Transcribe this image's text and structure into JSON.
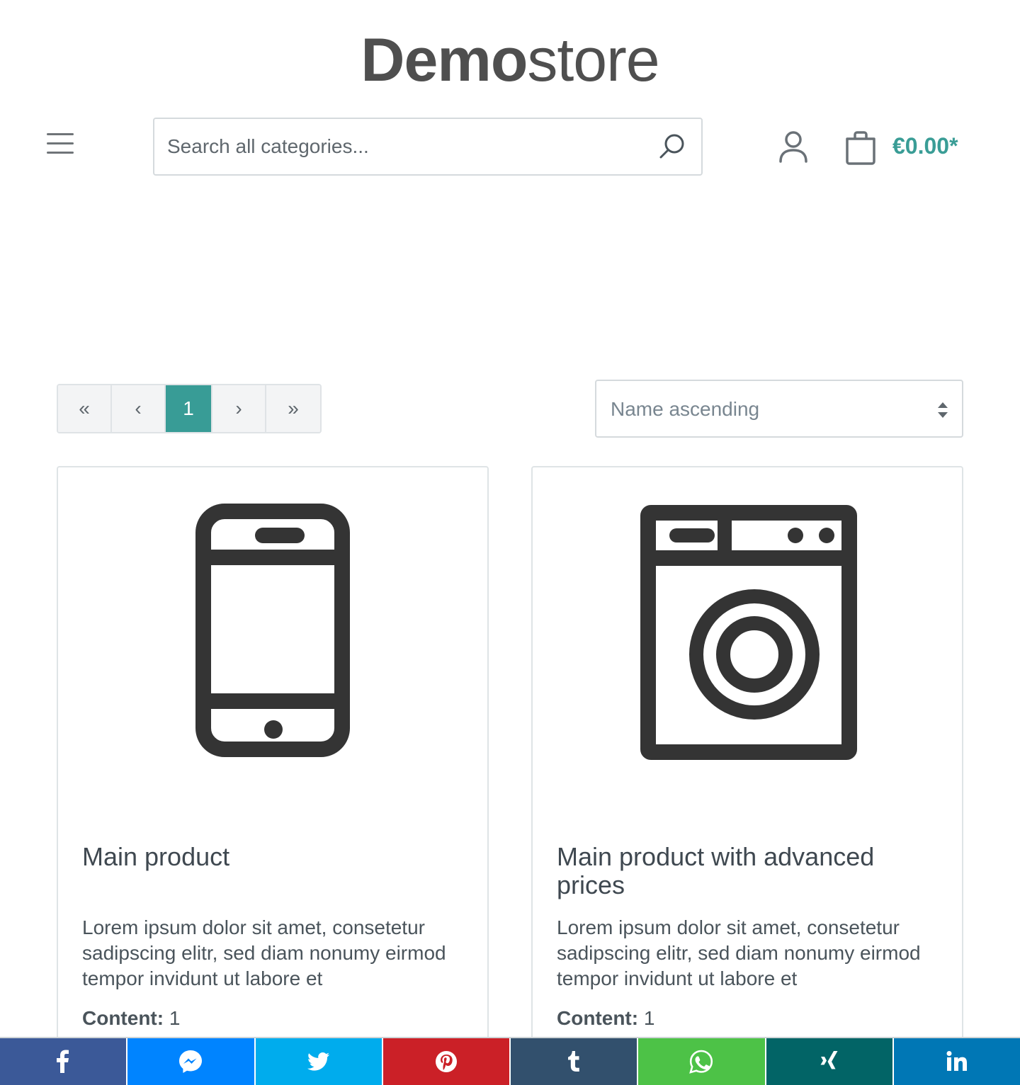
{
  "logo": {
    "bold": "Demo",
    "light": "store"
  },
  "search": {
    "placeholder": "Search all categories..."
  },
  "cart": {
    "price": "€0.00*"
  },
  "pagination": {
    "first": "«",
    "prev": "‹",
    "current": "1",
    "next": "›",
    "last": "»"
  },
  "sorting": {
    "selected": "Name ascending"
  },
  "products": [
    {
      "name": "Main product",
      "description": "Lorem ipsum dolor sit amet, consetetur sadipscing elitr, sed diam nonumy eirmod tempor invidunt ut labore et",
      "content_label": "Content:",
      "content_value": "1",
      "icon": "smartphone-icon"
    },
    {
      "name": "Main product with advanced prices",
      "description": "Lorem ipsum dolor sit amet, consetetur sadipscing elitr, sed diam nonumy eirmod tempor invidunt ut labore et",
      "content_label": "Content:",
      "content_value": "1",
      "icon": "washing-machine-icon"
    }
  ],
  "share": {
    "facebook": {
      "icon": "facebook-icon",
      "color": "#3b5998"
    },
    "messenger": {
      "icon": "messenger-icon",
      "color": "#0084ff"
    },
    "twitter": {
      "icon": "twitter-icon",
      "color": "#00aced"
    },
    "pinterest": {
      "icon": "pinterest-icon",
      "color": "#cb2027"
    },
    "tumblr": {
      "icon": "tumblr-icon",
      "color": "#32506d"
    },
    "whatsapp": {
      "icon": "whatsapp-icon",
      "color": "#4dc247"
    },
    "xing": {
      "icon": "xing-icon",
      "color": "#026466"
    },
    "linkedin": {
      "icon": "linkedin-icon",
      "color": "#0077b5"
    }
  },
  "colors": {
    "accent": "#389c96",
    "text": "#4a545b",
    "border": "#dfe3e6"
  }
}
